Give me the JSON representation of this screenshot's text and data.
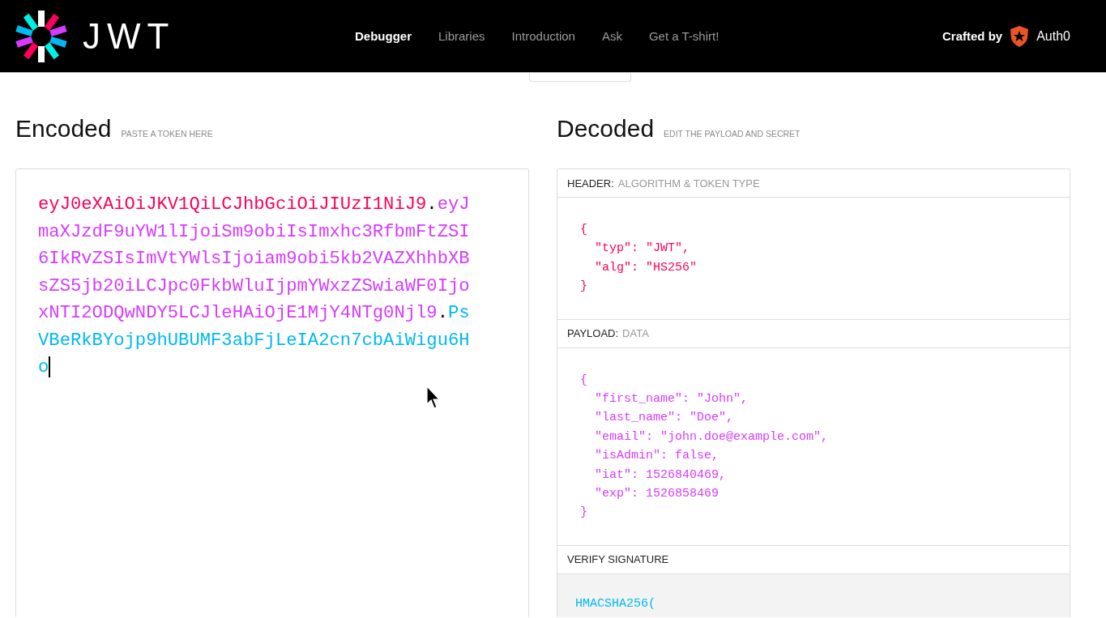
{
  "brand": {
    "name": "JWT"
  },
  "nav": [
    {
      "label": "Debugger",
      "selected": true
    },
    {
      "label": "Libraries",
      "selected": false
    },
    {
      "label": "Introduction",
      "selected": false
    },
    {
      "label": "Ask",
      "selected": false
    },
    {
      "label": "Get a T-shirt!",
      "selected": false
    }
  ],
  "crafted": {
    "label": "Crafted by",
    "company": "Auth0"
  },
  "encoded": {
    "title": "Encoded",
    "hint": "PASTE A TOKEN HERE",
    "segments": [
      {
        "text": "eyJ0eXAiOiJKV1QiLCJhbGciOiJIUzI1NiJ9",
        "color": "#fb015b"
      },
      {
        "text": ".",
        "color": "#000000"
      },
      {
        "text": "eyJmaXJzdF9uYW1lIjoiSm9obiIsImxhc3RfbmFtZSI6IkRvZSIsImVtYWlsIjoiam9obi5kb2VAZXhhbXBsZS5jb20iLCJpc0FkbWluIjpmYWxzZSwiaWF0IjoxNTI2ODQwNDY5LCJleHAiOjE1MjY4NTg0Njl9",
        "color": "#d63aff"
      },
      {
        "text": ".",
        "color": "#000000"
      },
      {
        "text": "PsVBeRkBYojp9hUBUMF3abFjLeIA2cn7cbAiWigu6Ho",
        "color": "#00b9f1"
      }
    ]
  },
  "decoded": {
    "title": "Decoded",
    "hint": "EDIT THE PAYLOAD AND SECRET",
    "sections": [
      {
        "label": "HEADER:",
        "sublabel": "ALGORITHM & TOKEN TYPE",
        "color": "#fb015b",
        "lines": [
          "{",
          "  \"typ\": \"JWT\",",
          "  \"alg\": \"HS256\"",
          "}"
        ]
      },
      {
        "label": "PAYLOAD:",
        "sublabel": "DATA",
        "color": "#d63aff",
        "lines": [
          "{",
          "  \"first_name\": \"John\",",
          "  \"last_name\": \"Doe\",",
          "  \"email\": \"john.doe@example.com\",",
          "  \"isAdmin\": false,",
          "  \"iat\": 1526840469,",
          "  \"exp\": 1526858469",
          "}"
        ]
      },
      {
        "label": "VERIFY SIGNATURE",
        "color": "#00b9f1",
        "lines": [
          "HMACSHA256("
        ]
      }
    ]
  }
}
